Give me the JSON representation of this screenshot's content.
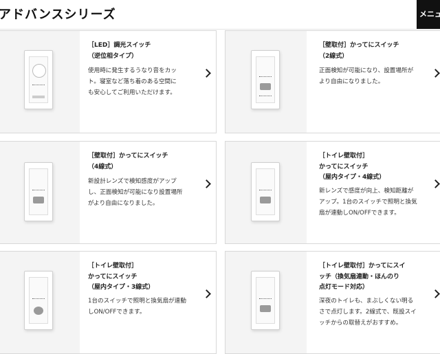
{
  "header": {
    "title": "アドバンスシリーズ",
    "menu_label": "メニュー"
  },
  "cards": [
    {
      "title": "［LED］調光スイッチ\n（逆位相タイプ）",
      "description": "使用時に発生するうなり音をカッ\nト。寝室など落ち着のある空間に\nも安心してご利用いただけます。"
    },
    {
      "title": "［壁取付］かってにスイッチ\n（2線式）",
      "description": "正面検知が可能になり、設置場所が\nより自由になりました。"
    },
    {
      "title": "［壁取付］かってにスイッチ\n（4線式）",
      "description": "新設計レンズで検知感度がアップ\nし、正面検知が可能になり設置場所\nがより自由になりました。"
    },
    {
      "title": "［トイレ壁取付］\nかってにスイッチ\n（屋内タイプ・4線式）",
      "description": "新レンズで感度が向上、検知距離が\nアップ。1台のスイッチで照明と換気\n扇が連動しON/OFFできます。"
    },
    {
      "title": "［トイレ壁取付］\nかってにスイッチ\n（屋内タイプ・3線式）",
      "description": "1台のスイッチで照明と換気扇が連動\nしON/OFFできます。"
    },
    {
      "title": "［トイレ壁取付］かってにスイ\nッチ（換気扇連動・ほんのり\n点灯モード対応）",
      "description": "深夜のトイレも、まぶしくない明る\nさで点灯します。2線式で、既設スイ\nッチからの取替えがおすすめ。"
    }
  ]
}
